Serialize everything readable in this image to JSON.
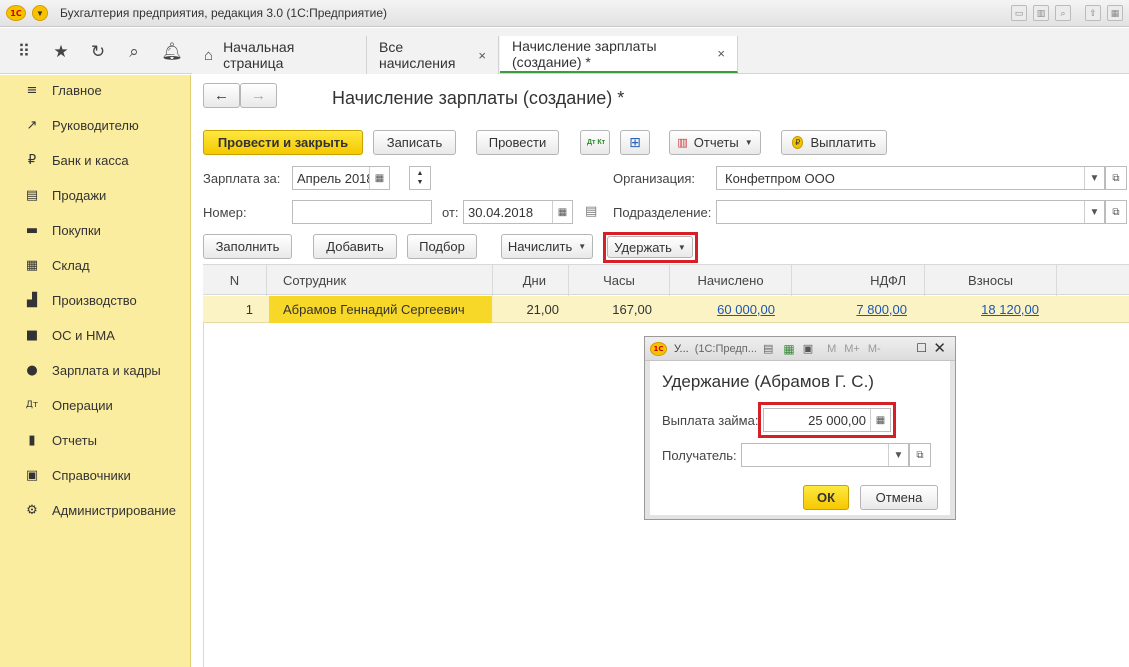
{
  "window": {
    "logo_text": "1С",
    "title": "Бухгалтерия предприятия, редакция 3.0  (1С:Предприятие)"
  },
  "tabs": [
    {
      "label": "Начальная страница"
    },
    {
      "label": "Все начисления",
      "close": "×"
    },
    {
      "label": "Начисление зарплаты (создание) *",
      "close": "×"
    }
  ],
  "sidebar": {
    "items": [
      {
        "label": "Главное",
        "icon": "≡"
      },
      {
        "label": "Руководителю",
        "icon": "↗"
      },
      {
        "label": "Банк и касса",
        "icon": "₽"
      },
      {
        "label": "Продажи",
        "icon": "▤"
      },
      {
        "label": "Покупки",
        "icon": "▬"
      },
      {
        "label": "Склад",
        "icon": "▦"
      },
      {
        "label": "Производство",
        "icon": "▟"
      },
      {
        "label": "ОС и НМА",
        "icon": "■"
      },
      {
        "label": "Зарплата и кадры",
        "icon": "●"
      },
      {
        "label": "Операции",
        "icon": "Дт"
      },
      {
        "label": "Отчеты",
        "icon": "▮"
      },
      {
        "label": "Справочники",
        "icon": "▣"
      },
      {
        "label": "Администрирование",
        "icon": "⚙"
      }
    ]
  },
  "document": {
    "title": "Начисление зарплаты (создание) *",
    "nav_back": "←",
    "nav_forward": "→",
    "toolbar": {
      "post_close": "Провести и закрыть",
      "save": "Записать",
      "post": "Провести",
      "dtkt": "Дт Кт",
      "reports": "Отчеты",
      "pay": "Выплатить"
    },
    "fields": {
      "salary_for_label": "Зарплата за:",
      "salary_for_value": "Апрель 2018",
      "organization_label": "Организация:",
      "organization_value": "Конфетпром ООО",
      "number_label": "Номер:",
      "number_value": "",
      "date_from_label": "от:",
      "date_value": "30.04.2018",
      "subdivision_label": "Подразделение:",
      "subdivision_value": ""
    },
    "actions": {
      "fill": "Заполнить",
      "add": "Добавить",
      "select": "Подбор",
      "accrue": "Начислить",
      "withhold": "Удержать"
    },
    "table": {
      "columns": [
        "N",
        "Сотрудник",
        "Дни",
        "Часы",
        "Начислено",
        "НДФЛ",
        "Взносы"
      ],
      "rows": [
        {
          "n": "1",
          "employee": "Абрамов Геннадий Сергеевич",
          "days": "21,00",
          "hours": "167,00",
          "accrued": "60 000,00",
          "ndfl": "7 800,00",
          "contributions": "18 120,00"
        }
      ]
    }
  },
  "dialog": {
    "window_title": "У...",
    "window_subtitle": "(1С:Предп...",
    "heading": "Удержание (Абрамов Г. С.)",
    "loan_label": "Выплата займа:",
    "loan_value": "25 000,00",
    "recipient_label": "Получатель:",
    "recipient_value": "",
    "ok": "ОК",
    "cancel": "Отмена",
    "tb_m": "M",
    "tb_mplus": "M+",
    "tb_mminus": "M-"
  }
}
